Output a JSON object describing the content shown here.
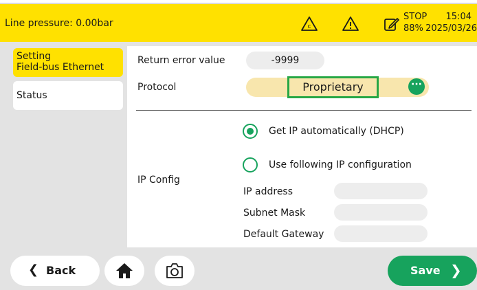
{
  "header": {
    "title": "Line pressure: 0.00bar",
    "icons": [
      "c-warning-icon",
      "warning-icon",
      "edit-document-icon"
    ],
    "status_line1": "STOP",
    "status_line2": "88%",
    "time": "15:04",
    "date": "2025/03/26",
    "accent": "#ffe100"
  },
  "sidebar": {
    "items": [
      {
        "line1": "Setting",
        "line2": "Field-bus Ethernet",
        "active": true
      },
      {
        "line1": "Status",
        "active": false
      }
    ]
  },
  "form": {
    "return_error_label": "Return error value",
    "return_error_value": "-9999",
    "protocol_label": "Protocol",
    "protocol_value": "Proprietary",
    "ip_config_label": "IP Config",
    "options": [
      {
        "label": "Get IP automatically (DHCP)",
        "selected": true
      },
      {
        "label": "Use following IP configuration",
        "selected": false
      }
    ],
    "fields": [
      {
        "label": "IP address",
        "value": ""
      },
      {
        "label": "Subnet Mask",
        "value": ""
      },
      {
        "label": "Default Gateway",
        "value": ""
      }
    ]
  },
  "footer": {
    "back_label": "Back",
    "save_label": "Save",
    "save_color": "#17a35d"
  }
}
